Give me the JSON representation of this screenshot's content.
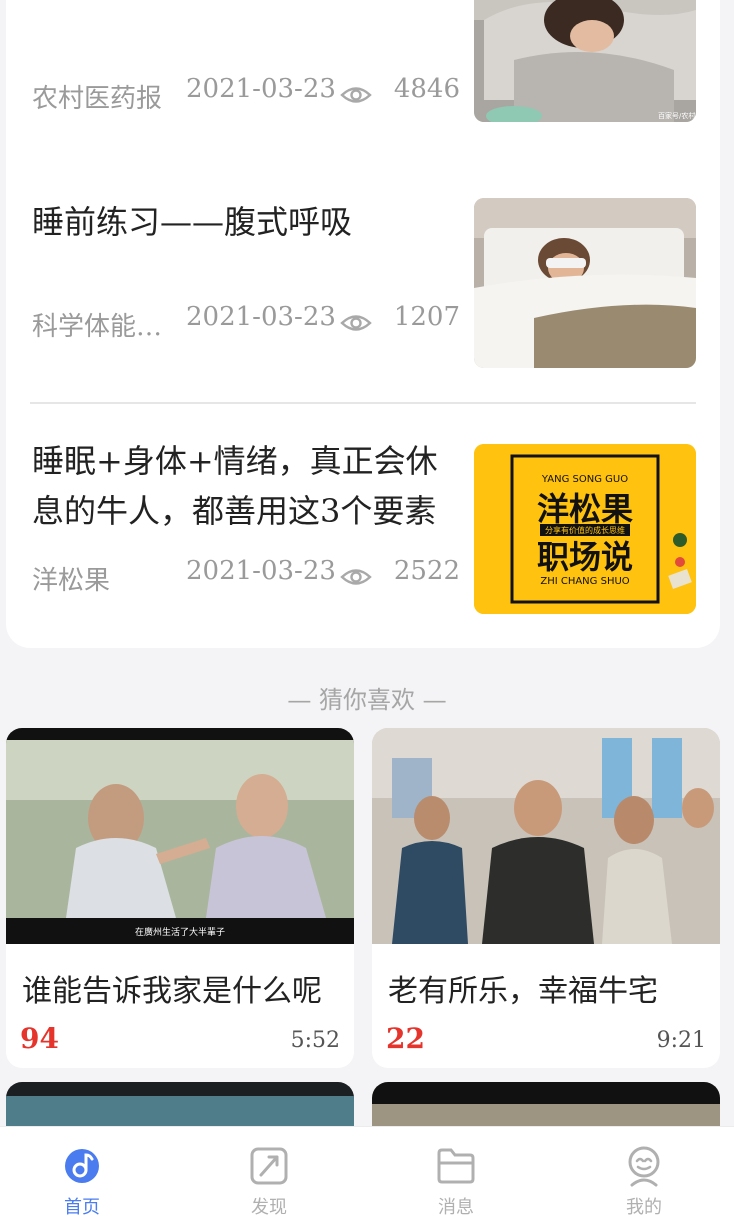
{
  "articles": [
    {
      "title": "",
      "source": "农村医药报",
      "date": "2021-03-23",
      "views": "4846",
      "thumb_watermark": "百家号/农村"
    },
    {
      "title": "睡前练习——腹式呼吸",
      "source": "科学体能训练",
      "date": "2021-03-23",
      "views": "1207"
    },
    {
      "title": "睡眠+身体+情绪，真正会休息的牛人，都善用这3个要素",
      "source": "洋松果",
      "date": "2021-03-23",
      "views": "2522",
      "thumb": {
        "line1": "YANG SONG GUO",
        "big1": "洋松果",
        "tag": "分享有价值的成长思维",
        "big2": "职场说",
        "line2": "ZHI CHANG SHUO"
      }
    }
  ],
  "section_label": "— 猜你喜欢 —",
  "videos": [
    {
      "title": "谁能告诉我家是什么呢",
      "count": "94",
      "duration": "5:52",
      "caption": "在廣州生活了大半輩子"
    },
    {
      "title": "老有所乐，幸福牛宅",
      "count": "22",
      "duration": "9:21"
    }
  ],
  "tabbar": {
    "items": [
      {
        "label": "首页",
        "icon": "music-disc-icon",
        "active": true
      },
      {
        "label": "发现",
        "icon": "discover-icon",
        "active": false
      },
      {
        "label": "消息",
        "icon": "folder-icon",
        "active": false
      },
      {
        "label": "我的",
        "icon": "profile-icon",
        "active": false
      }
    ]
  },
  "colors": {
    "accent": "#4a7cf0",
    "count_red": "#e5342c",
    "muted": "#9a9a9a",
    "thumb_yellow": "#ffc20e"
  }
}
